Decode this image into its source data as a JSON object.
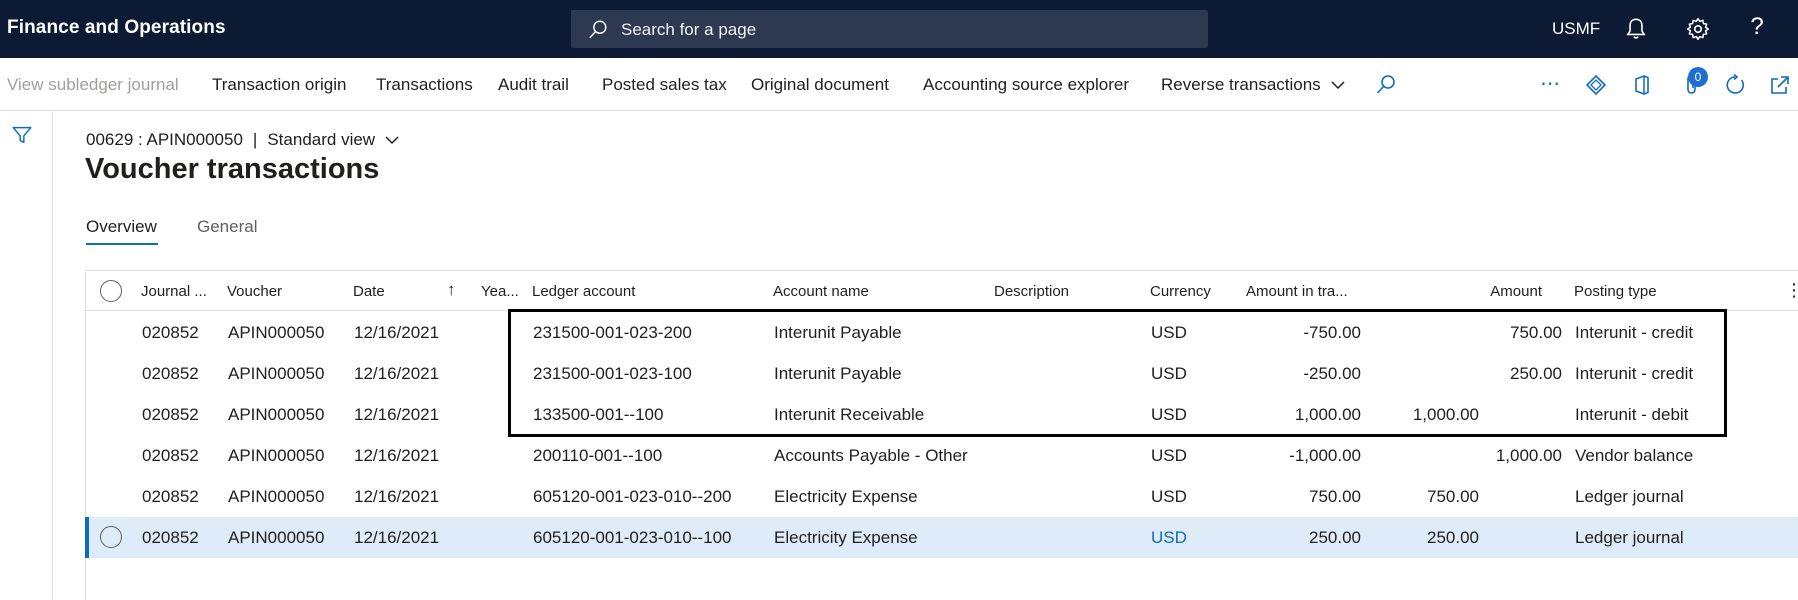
{
  "topbar": {
    "app_title": "Finance and Operations",
    "search_placeholder": "Search for a page",
    "company": "USMF",
    "help_glyph": "?",
    "icons": [
      "search-icon",
      "bell-icon",
      "gear-icon",
      "help-icon"
    ]
  },
  "actions": [
    {
      "label": "View subledger journal",
      "disabled": true
    },
    {
      "label": "Transaction origin"
    },
    {
      "label": "Transactions"
    },
    {
      "label": "Audit trail"
    },
    {
      "label": "Posted sales tax"
    },
    {
      "label": "Original document"
    },
    {
      "label": "Accounting source explorer"
    },
    {
      "label": "Reverse transactions"
    }
  ],
  "action_icons": {
    "more": "⋯",
    "badge_count": "0"
  },
  "header": {
    "breadcrumb_record": "00629 : APIN000050",
    "breadcrumb_sep": "|",
    "view_label": "Standard view",
    "page_title": "Voucher transactions"
  },
  "tabs": [
    {
      "label": "Overview",
      "active": true
    },
    {
      "label": "General",
      "active": false
    }
  ],
  "grid": {
    "columns": {
      "journal": "Journal ...",
      "voucher": "Voucher",
      "date": "Date",
      "year": "Yea...",
      "ledger": "Ledger account",
      "account_name": "Account name",
      "description": "Description",
      "currency": "Currency",
      "amount_tra": "Amount in tra...",
      "amount": "Amount",
      "posting_type": "Posting type"
    },
    "sort_arrow": "↑",
    "more_glyph": "⋮",
    "rows": [
      {
        "journal": "020852",
        "voucher": "APIN000050",
        "date": "12/16/2021",
        "ledger": "231500-001-023-200",
        "account_name": "Interunit Payable",
        "currency": "USD",
        "amount_tra": "-750.00",
        "debit": "",
        "amount": "750.00",
        "posting_type": "Interunit - credit"
      },
      {
        "journal": "020852",
        "voucher": "APIN000050",
        "date": "12/16/2021",
        "ledger": "231500-001-023-100",
        "account_name": "Interunit Payable",
        "currency": "USD",
        "amount_tra": "-250.00",
        "debit": "",
        "amount": "250.00",
        "posting_type": "Interunit - credit"
      },
      {
        "journal": "020852",
        "voucher": "APIN000050",
        "date": "12/16/2021",
        "ledger": "133500-001--100",
        "account_name": "Interunit Receivable",
        "currency": "USD",
        "amount_tra": "1,000.00",
        "debit": "1,000.00",
        "amount": "",
        "posting_type": "Interunit - debit"
      },
      {
        "journal": "020852",
        "voucher": "APIN000050",
        "date": "12/16/2021",
        "ledger": "200110-001--100",
        "account_name": "Accounts Payable - Other",
        "currency": "USD",
        "amount_tra": "-1,000.00",
        "debit": "",
        "amount": "1,000.00",
        "posting_type": "Vendor balance"
      },
      {
        "journal": "020852",
        "voucher": "APIN000050",
        "date": "12/16/2021",
        "ledger": "605120-001-023-010--200",
        "account_name": "Electricity Expense",
        "currency": "USD",
        "amount_tra": "750.00",
        "debit": "750.00",
        "amount": "",
        "posting_type": "Ledger journal"
      },
      {
        "journal": "020852",
        "voucher": "APIN000050",
        "date": "12/16/2021",
        "ledger": "605120-001-023-010--100",
        "account_name": "Electricity Expense",
        "currency": "USD",
        "amount_tra": "250.00",
        "debit": "250.00",
        "amount": "",
        "posting_type": "Ledger journal",
        "selected": true
      }
    ]
  },
  "colors": {
    "topbar": "#0c1a33",
    "accent": "#0f6cbd",
    "selected_row": "#deecf9"
  }
}
